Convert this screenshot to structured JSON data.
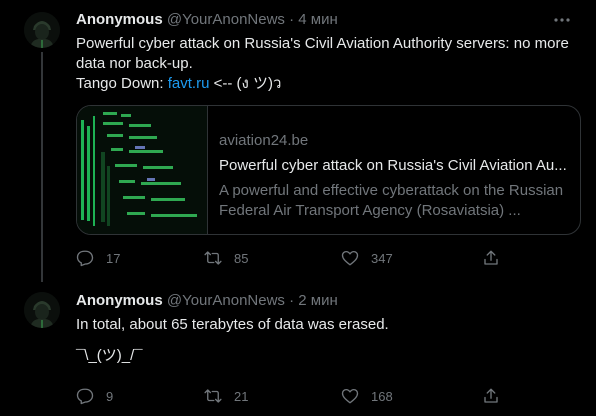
{
  "tweets": [
    {
      "display_name": "Anonymous",
      "handle": "@YourAnonNews",
      "separator": "·",
      "time": "4 мин",
      "text_line1": "Powerful cyber attack on Russia's Civil Aviation Authority servers: no more data nor back-up.",
      "text_line2_prefix": "Tango Down: ",
      "link_text": "favt.ru",
      "text_line2_suffix": " <-- (ง ツ)ว",
      "card": {
        "domain": "aviation24.be",
        "title": "Powerful cyber attack on Russia's Civil Aviation Au...",
        "description": "A powerful and effective cyberattack on the Russian Federal Air Transport Agency (Rosaviatsia) ..."
      },
      "replies": "17",
      "retweets": "85",
      "likes": "347"
    },
    {
      "display_name": "Anonymous",
      "handle": "@YourAnonNews",
      "separator": "·",
      "time": "2 мин",
      "text_line1": "In total, about 65 terabytes of data was erased.",
      "text_line2": "¯\\_(ツ)_/¯",
      "replies": "9",
      "retweets": "21",
      "likes": "168"
    }
  ],
  "icons": {
    "more": "more-icon",
    "reply": "reply-icon",
    "retweet": "retweet-icon",
    "like": "heart-icon",
    "share": "share-icon"
  },
  "colors": {
    "background": "#000000",
    "text": "#e7e9ea",
    "muted": "#71767b",
    "link": "#1d9bf0",
    "border": "#2f3336"
  }
}
